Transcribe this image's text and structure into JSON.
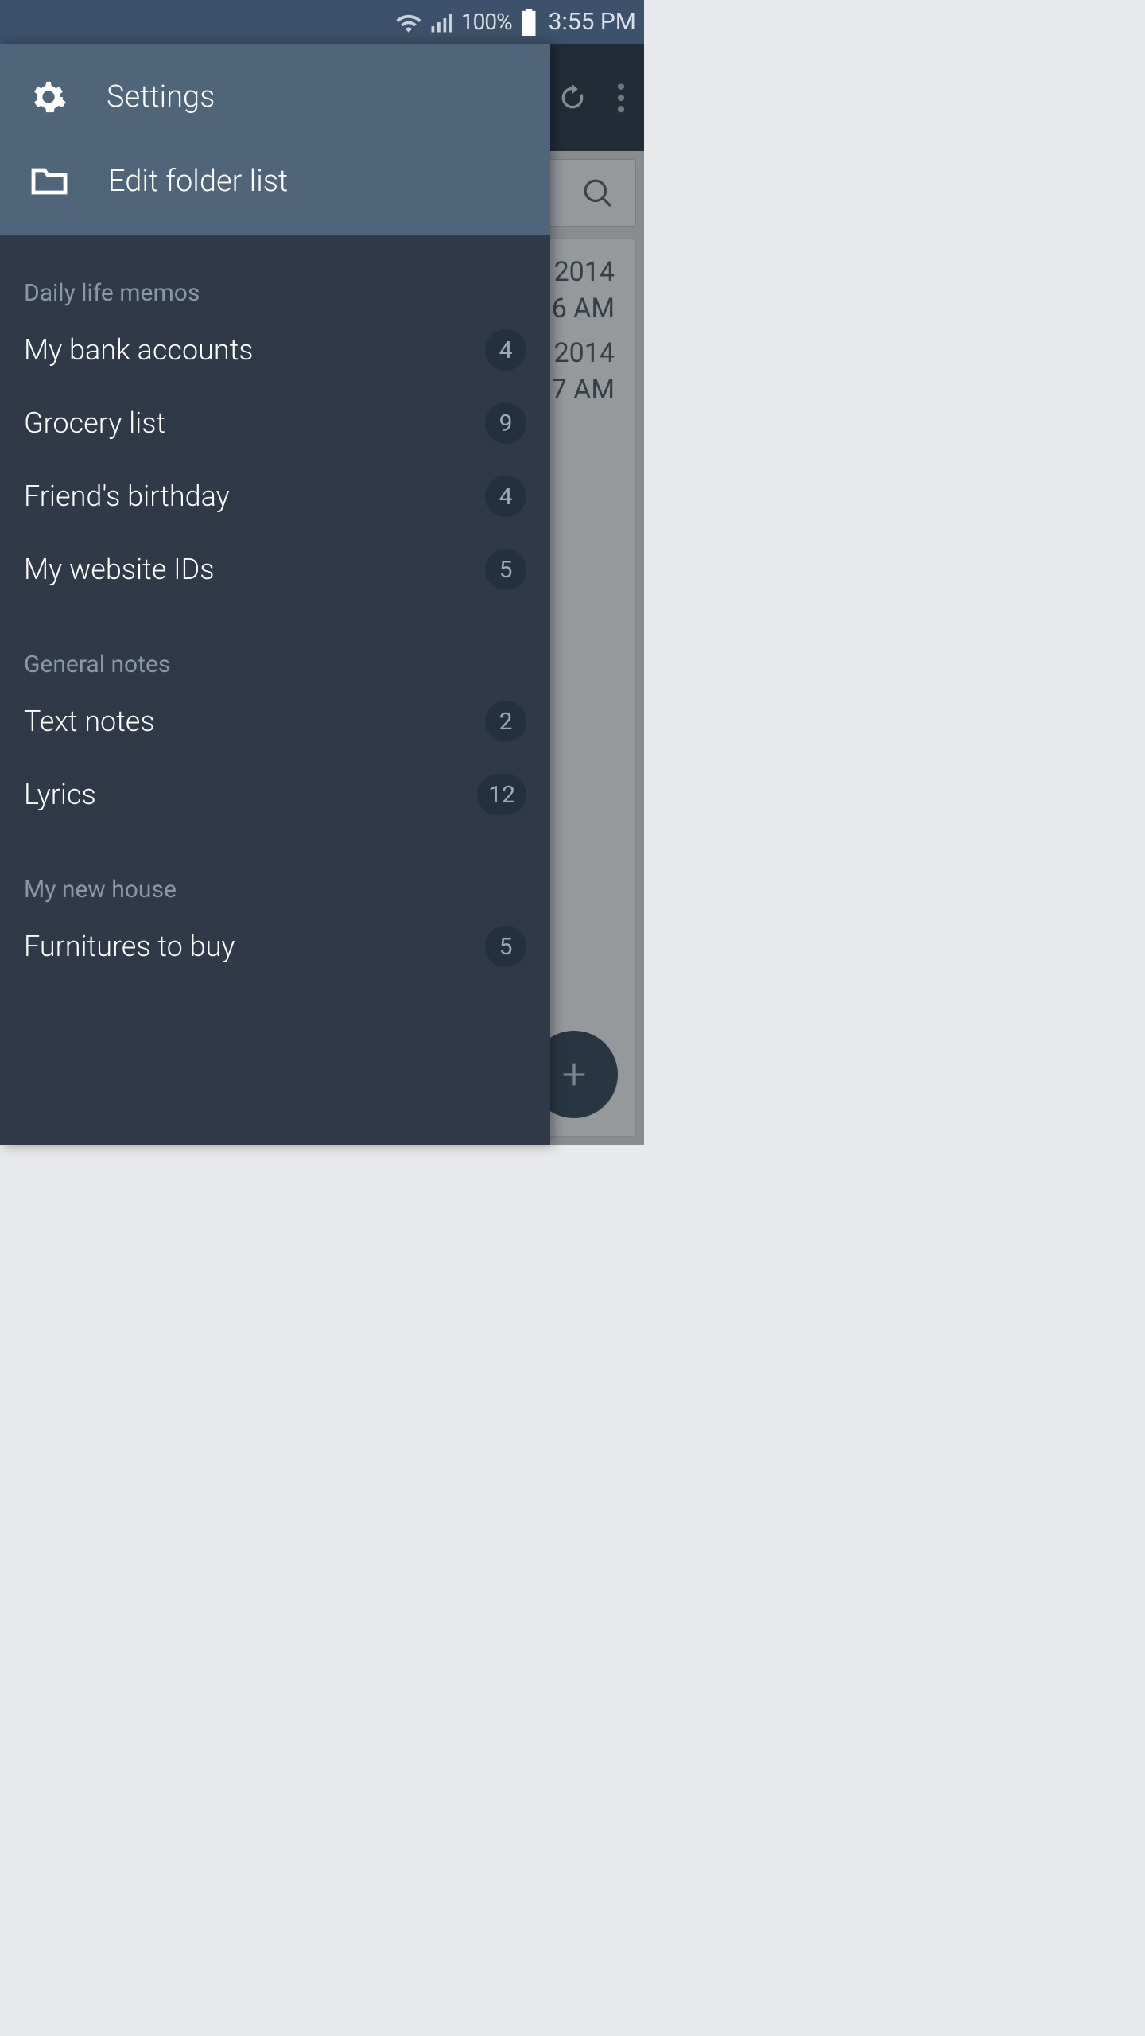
{
  "status": {
    "battery_pct": "100%",
    "time": "3:55 PM"
  },
  "drawer": {
    "settings_label": "Settings",
    "edit_folders_label": "Edit folder list",
    "sections": [
      {
        "title": "Daily life memos",
        "items": [
          {
            "name": "My bank accounts",
            "count": "4"
          },
          {
            "name": "Grocery list",
            "count": "9"
          },
          {
            "name": "Friend's birthday",
            "count": "4"
          },
          {
            "name": "My website IDs",
            "count": "5"
          }
        ]
      },
      {
        "title": "General notes",
        "items": [
          {
            "name": "Text notes",
            "count": "2"
          },
          {
            "name": "Lyrics",
            "count": "12"
          }
        ]
      },
      {
        "title": "My new house",
        "items": [
          {
            "name": "Furnitures to buy",
            "count": "5"
          }
        ]
      }
    ]
  },
  "bg": {
    "row1_date": "2014",
    "row1_time": "6 AM",
    "row2_date": "2014",
    "row2_time": "7 AM"
  }
}
